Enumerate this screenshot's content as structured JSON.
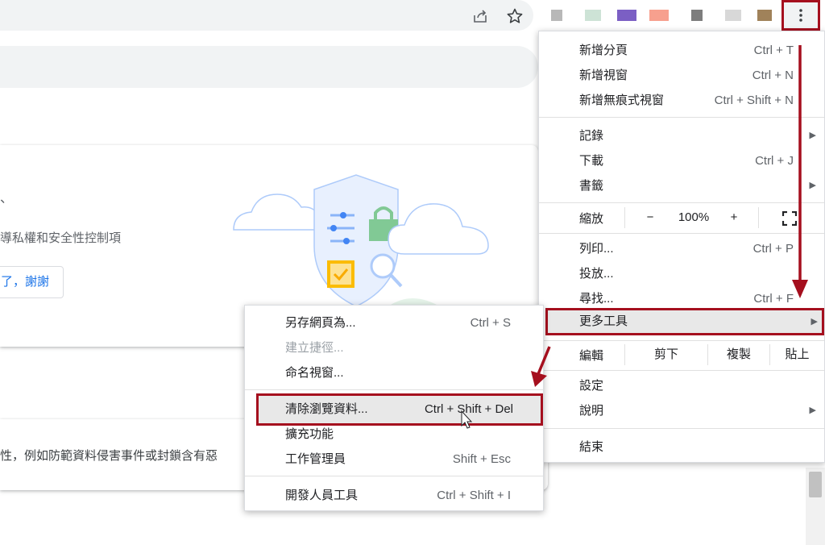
{
  "toolbar": {
    "share_icon": "share-icon",
    "bookmark_icon": "star-icon",
    "menu_icon": "kebab-menu-icon",
    "extension_colors": [
      "#b8b8b8",
      "#cde3d6",
      "#7b5fc4",
      "#f7a08e",
      "#7d7d7d",
      "#d8d8d8",
      "#a0825a"
    ]
  },
  "page": {
    "card_tick": "、",
    "card_text": "導私權和安全性控制項",
    "card_button": "了，謝謝",
    "card2_text": "性，例如防範資料侵害事件或封鎖含有惡"
  },
  "menu": {
    "new_tab": {
      "label": "新增分頁",
      "shortcut": "Ctrl + T"
    },
    "new_window": {
      "label": "新增視窗",
      "shortcut": "Ctrl + N"
    },
    "incognito": {
      "label": "新增無痕式視窗",
      "shortcut": "Ctrl + Shift + N"
    },
    "history": {
      "label": "記錄"
    },
    "downloads": {
      "label": "下載",
      "shortcut": "Ctrl + J"
    },
    "bookmarks": {
      "label": "書籤"
    },
    "zoom": {
      "label": "縮放",
      "minus": "−",
      "value": "100%",
      "plus": "+"
    },
    "print": {
      "label": "列印...",
      "shortcut": "Ctrl + P"
    },
    "cast": {
      "label": "投放..."
    },
    "find": {
      "label": "尋找...",
      "shortcut": "Ctrl + F"
    },
    "more_tools": {
      "label": "更多工具"
    },
    "edit": {
      "label": "編輯",
      "cut": "剪下",
      "copy": "複製",
      "paste": "貼上"
    },
    "settings": {
      "label": "設定"
    },
    "help": {
      "label": "說明"
    },
    "exit": {
      "label": "結束"
    }
  },
  "submenu": {
    "save_page": {
      "label": "另存網頁為...",
      "shortcut": "Ctrl + S"
    },
    "create_shortcut": {
      "label": "建立捷徑..."
    },
    "name_window": {
      "label": "命名視窗..."
    },
    "clear_data": {
      "label": "清除瀏覽資料...",
      "shortcut": "Ctrl + Shift + Del"
    },
    "extensions": {
      "label": "擴充功能"
    },
    "task_manager": {
      "label": "工作管理員",
      "shortcut": "Shift + Esc"
    },
    "dev_tools": {
      "label": "開發人員工具",
      "shortcut": "Ctrl + Shift + I"
    }
  },
  "annotation_color": "#a50f1e"
}
